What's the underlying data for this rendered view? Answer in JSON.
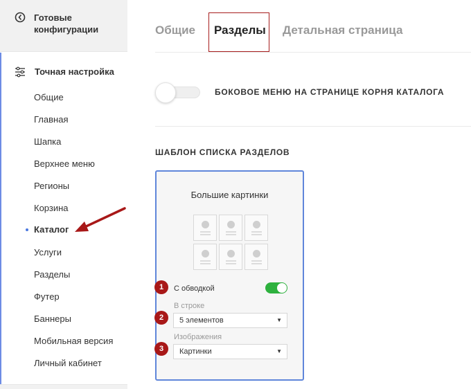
{
  "sidebar": {
    "ready_configs": {
      "label": "Готовые конфигурации",
      "icon": "config-circle-icon"
    },
    "fine_tuning": {
      "label": "Точная настройка",
      "icon": "sliders-icon"
    },
    "items": [
      {
        "label": "Общие"
      },
      {
        "label": "Главная"
      },
      {
        "label": "Шапка"
      },
      {
        "label": "Верхнее меню"
      },
      {
        "label": "Регионы"
      },
      {
        "label": "Корзина"
      },
      {
        "label": "Каталог",
        "active": true
      },
      {
        "label": "Услуги"
      },
      {
        "label": "Разделы"
      },
      {
        "label": "Футер"
      },
      {
        "label": "Баннеры"
      },
      {
        "label": "Мобильная версия"
      },
      {
        "label": "Личный кабинет"
      }
    ],
    "accent_color": "#6d8ce4"
  },
  "tabs": [
    {
      "label": "Общие",
      "active": false
    },
    {
      "label": "Разделы",
      "active": true
    },
    {
      "label": "Детальная страница",
      "active": false
    }
  ],
  "root_menu_toggle": {
    "label": "БОКОВОЕ МЕНЮ НА СТРАНИЦЕ КОРНЯ КАТАЛОГА",
    "enabled": false
  },
  "section_template": {
    "title": "ШАБЛОН СПИСКА РАЗДЕЛОВ",
    "card_title": "Большие картинки",
    "border_option": {
      "label": "С обводкой",
      "enabled": true
    },
    "per_row": {
      "caption": "В строке",
      "value": "5 элементов"
    },
    "images": {
      "caption": "Изображения",
      "value": "Картинки"
    }
  },
  "badges": [
    "1",
    "2",
    "3"
  ],
  "colors": {
    "badge": "#a81818",
    "toggle_on": "#2eb13e",
    "card_border": "#5f86da",
    "tab_highlight": "#a61c1c"
  }
}
